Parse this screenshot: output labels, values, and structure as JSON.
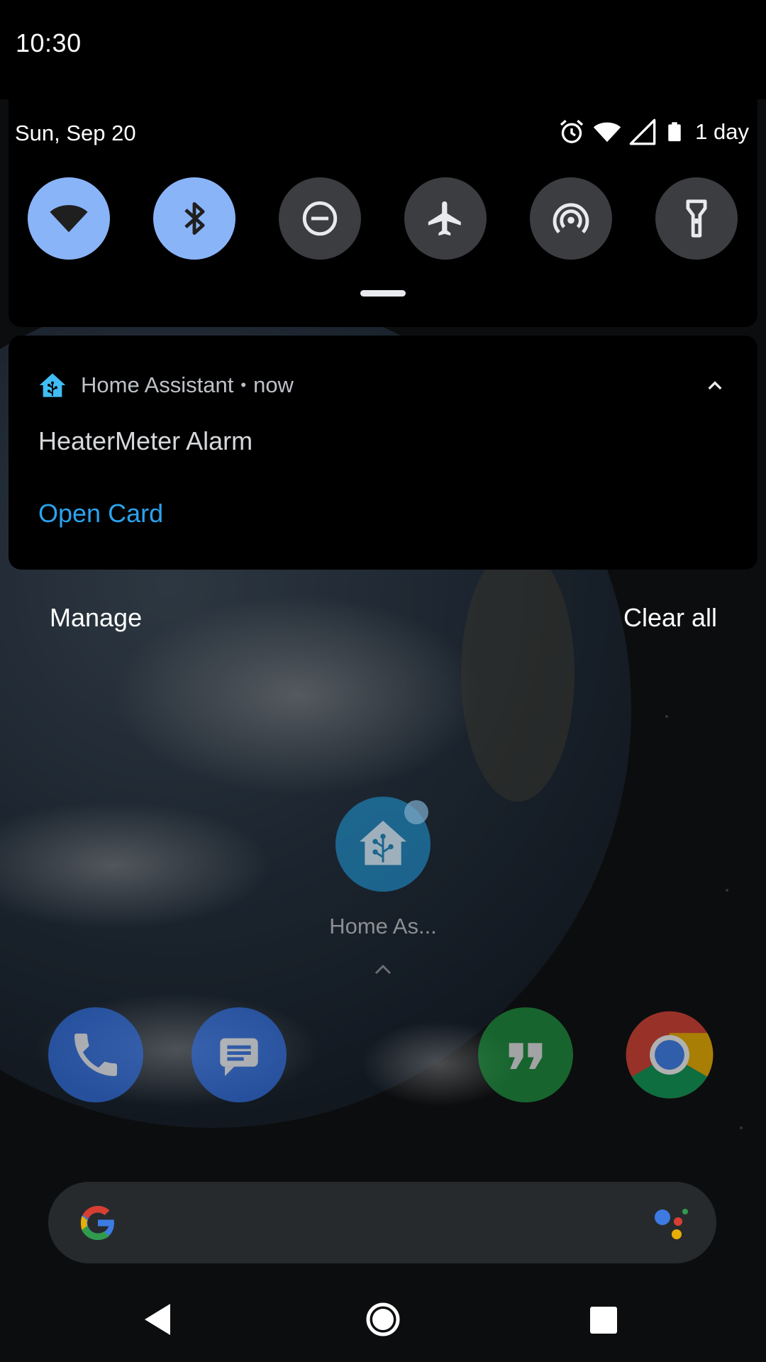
{
  "status_bar": {
    "time": "10:30",
    "date": "Sun, Sep 20",
    "battery_text": "1 day",
    "icons": [
      "alarm-icon",
      "wifi-icon",
      "cell-signal-icon",
      "battery-icon"
    ]
  },
  "quick_settings": {
    "tiles": [
      {
        "name": "wifi",
        "icon": "wifi-icon",
        "state": "on"
      },
      {
        "name": "bluetooth",
        "icon": "bluetooth-icon",
        "state": "on"
      },
      {
        "name": "do-not-disturb",
        "icon": "do-not-disturb-icon",
        "state": "off"
      },
      {
        "name": "airplane-mode",
        "icon": "airplane-icon",
        "state": "off"
      },
      {
        "name": "hotspot",
        "icon": "hotspot-icon",
        "state": "off"
      },
      {
        "name": "flashlight",
        "icon": "flashlight-icon",
        "state": "off"
      }
    ]
  },
  "notification": {
    "app_name": "Home Assistant",
    "separator": "•",
    "time": "now",
    "title": "HeaterMeter Alarm",
    "action_label": "Open Card"
  },
  "footer": {
    "manage_label": "Manage",
    "clear_all_label": "Clear all"
  },
  "home_screen": {
    "app_label": "Home As...",
    "dock": [
      "phone-icon",
      "messages-icon",
      "hangouts-icon",
      "chrome-icon"
    ]
  },
  "colors": {
    "tile_on": "#8ab4f8",
    "tile_off": "#3c3d40",
    "action_blue": "#2ba3ee",
    "ha_blue": "#41bdf5"
  }
}
